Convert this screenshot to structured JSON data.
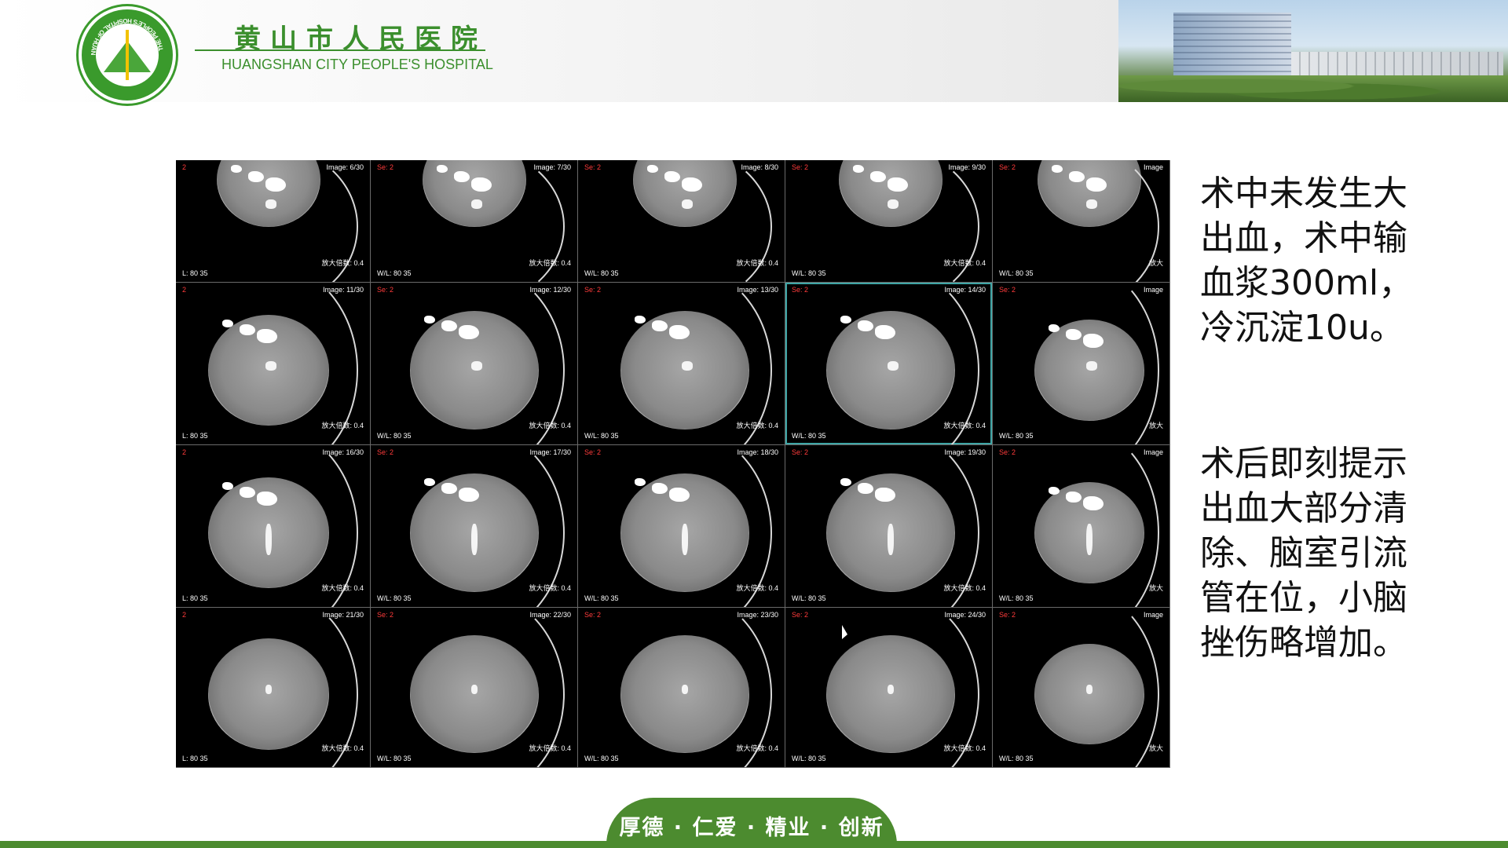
{
  "header": {
    "hospital_name_cn": "黄山市人民医院",
    "hospital_name_en": "HUANGSHAN CITY PEOPLE'S HOSPITAL",
    "logo_ring_text": "THE PEOPLE'S HOSPITAL OF HUANGSHAN",
    "logo_top_text": "黄山市人民医院"
  },
  "ct_grid": {
    "rows": [
      [
        {
          "se": "2",
          "image": "Image: 6/30",
          "zoom": "放大倍数: 0.4",
          "wl": "L: 80 35"
        },
        {
          "se": "Se: 2",
          "image": "Image: 7/30",
          "zoom": "放大倍数: 0.4",
          "wl": "W/L: 80 35"
        },
        {
          "se": "Se: 2",
          "image": "Image: 8/30",
          "zoom": "放大倍数: 0.4",
          "wl": "W/L: 80 35"
        },
        {
          "se": "Se: 2",
          "image": "Image: 9/30",
          "zoom": "放大倍数: 0.4",
          "wl": "W/L: 80 35"
        },
        {
          "se": "Se: 2",
          "image": "Image",
          "zoom": "放大",
          "wl": "W/L: 80 35"
        }
      ],
      [
        {
          "se": "2",
          "image": "Image: 11/30",
          "zoom": "放大倍数: 0.4",
          "wl": "L: 80 35"
        },
        {
          "se": "Se: 2",
          "image": "Image: 12/30",
          "zoom": "放大倍数: 0.4",
          "wl": "W/L: 80 35"
        },
        {
          "se": "Se: 2",
          "image": "Image: 13/30",
          "zoom": "放大倍数: 0.4",
          "wl": "W/L: 80 35"
        },
        {
          "se": "Se: 2",
          "image": "Image: 14/30",
          "zoom": "放大倍数: 0.4",
          "wl": "W/L: 80 35"
        },
        {
          "se": "Se: 2",
          "image": "Image",
          "zoom": "放大",
          "wl": "W/L: 80 35"
        }
      ],
      [
        {
          "se": "2",
          "image": "Image: 16/30",
          "zoom": "放大倍数: 0.4",
          "wl": "L: 80 35"
        },
        {
          "se": "Se: 2",
          "image": "Image: 17/30",
          "zoom": "放大倍数: 0.4",
          "wl": "W/L: 80 35"
        },
        {
          "se": "Se: 2",
          "image": "Image: 18/30",
          "zoom": "放大倍数: 0.4",
          "wl": "W/L: 80 35"
        },
        {
          "se": "Se: 2",
          "image": "Image: 19/30",
          "zoom": "放大倍数: 0.4",
          "wl": "W/L: 80 35"
        },
        {
          "se": "Se: 2",
          "image": "Image",
          "zoom": "放大",
          "wl": "W/L: 80 35"
        }
      ],
      [
        {
          "se": "2",
          "image": "Image: 21/30",
          "zoom": "放大倍数: 0.4",
          "wl": "L: 80 35"
        },
        {
          "se": "Se: 2",
          "image": "Image: 22/30",
          "zoom": "放大倍数: 0.4",
          "wl": "W/L: 80 35"
        },
        {
          "se": "Se: 2",
          "image": "Image: 23/30",
          "zoom": "放大倍数: 0.4",
          "wl": "W/L: 80 35"
        },
        {
          "se": "Se: 2",
          "image": "Image: 24/30",
          "zoom": "放大倍数: 0.4",
          "wl": "W/L: 80 35"
        },
        {
          "se": "Se: 2",
          "image": "Image",
          "zoom": "放大",
          "wl": "W/L: 80 35"
        }
      ]
    ],
    "active_cell": "Image: 14/30"
  },
  "side_text": {
    "paragraph1": "术中未发生大出血，术中输血浆300ml，冷沉淀10u。",
    "paragraph2": "术后即刻提示出血大部分清除、脑室引流管在位，小脑挫伤略增加。"
  },
  "footer": {
    "slogan": "厚德 · 仁爱 · 精业 · 创新"
  },
  "colors": {
    "brand_green": "#4c8b2f",
    "series_label_red": "#ff3b3b",
    "active_cell_outline": "#3fa6a6"
  }
}
